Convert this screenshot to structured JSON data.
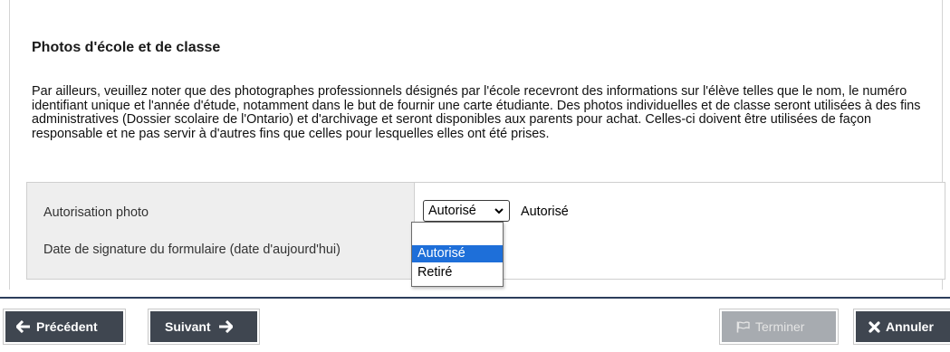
{
  "section": {
    "title": "Photos d'école et de classe",
    "notice": "Par ailleurs, veuillez noter que des photographes professionnels désignés par l'école recevront des informations sur l'élève telles que le nom, le numéro identifiant unique et l'année d'étude, notamment dans le but de fournir une carte étudiante. Des photos individuelles et de classe seront utilisées à des fins administratives (Dossier scolaire de l'Ontario) et d'archivage et seront disponibles aux parents pour achat. Celles-ci doivent être utilisées de façon responsable et ne pas servir à d'autres fins que celles pour lesquelles elles ont été prises."
  },
  "form": {
    "photo_label": "Autorisation photo",
    "photo_select_value": "Autorisé",
    "photo_current_value": "Autorisé",
    "date_label": "Date de signature du formulaire (date d'aujourd'hui)"
  },
  "dropdown": {
    "options": [
      "",
      "Autorisé",
      "Retiré"
    ],
    "highlighted": "Autorisé"
  },
  "buttons": {
    "previous": "Précédent",
    "next": "Suivant",
    "finish": "Terminer",
    "cancel": "Annuler"
  },
  "colors": {
    "button_bg": "#3f4650",
    "button_disabled_bg": "#a7abb0",
    "highlight": "#1e6fd9",
    "separator": "#2c3e5c"
  }
}
